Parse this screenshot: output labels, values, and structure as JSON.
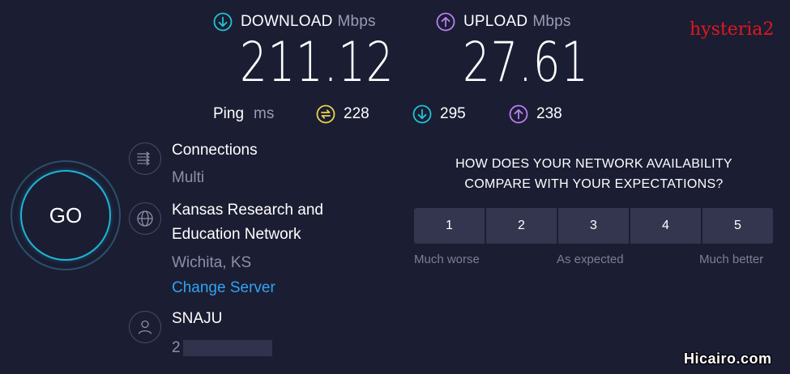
{
  "header": {
    "download_label": "DOWNLOAD",
    "upload_label": "UPLOAD",
    "unit": "Mbps",
    "download_value": "211.12",
    "upload_value": "27.61",
    "watermark_label": "hysteria2"
  },
  "ping": {
    "label": "Ping",
    "unit": "ms",
    "idle": "228",
    "download": "295",
    "upload": "238"
  },
  "go_button": {
    "label": "GO"
  },
  "info": {
    "connections_title": "Connections",
    "connections_value": "Multi",
    "server_name_line1": "Kansas Research and",
    "server_name_line2": "Education Network",
    "server_location": "Wichita, KS",
    "change_server": "Change Server",
    "isp_name": "SNAJU",
    "isp_ip_partial": "2"
  },
  "survey": {
    "question_line1": "HOW DOES YOUR NETWORK AVAILABILITY",
    "question_line2": "COMPARE WITH YOUR EXPECTATIONS?",
    "options": [
      "1",
      "2",
      "3",
      "4",
      "5"
    ],
    "label_low": "Much worse",
    "label_mid": "As expected",
    "label_high": "Much better"
  },
  "footer": {
    "site": "Hicairo.com"
  },
  "colors": {
    "background": "#1b1d33",
    "download_accent": "#1fc4d4",
    "upload_accent": "#b77ff0",
    "ping_idle_accent": "#e8d44d",
    "link": "#2fa4f2",
    "watermark_red": "#e0181c"
  }
}
